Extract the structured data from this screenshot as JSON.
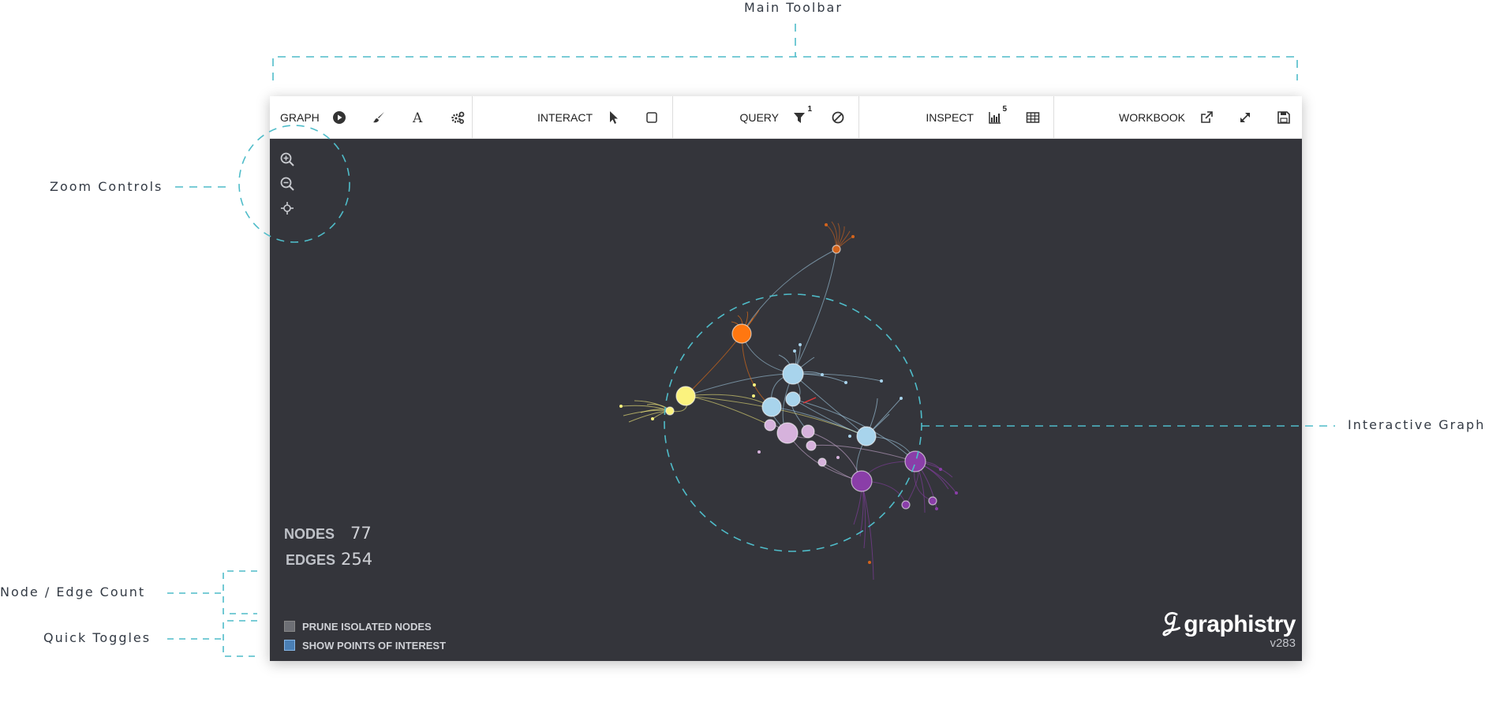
{
  "callouts": {
    "main_toolbar": "Main Toolbar",
    "zoom_controls": "Zoom Controls",
    "interactive_graph": "Interactive Graph",
    "node_edge_count": "Node / Edge Count",
    "quick_toggles": "Quick Toggles"
  },
  "toolbar": {
    "graph": {
      "label": "GRAPH",
      "icons": [
        "play-icon",
        "brush-icon",
        "font-icon",
        "gears-icon"
      ]
    },
    "interact": {
      "label": "INTERACT",
      "icons": [
        "pointer-icon",
        "box-select-icon"
      ]
    },
    "query": {
      "label": "QUERY",
      "filter_badge": "1",
      "icons": [
        "filter-icon",
        "exclude-icon"
      ]
    },
    "inspect": {
      "label": "INSPECT",
      "histogram_badge": "5",
      "icons": [
        "histogram-icon",
        "table-icon"
      ]
    },
    "workbook": {
      "label": "WORKBOOK",
      "icons": [
        "external-link-icon",
        "fullscreen-icon",
        "save-icon"
      ]
    }
  },
  "zoom": [
    "zoom-in-icon",
    "zoom-out-icon",
    "center-icon"
  ],
  "stats": {
    "nodes_label": "NODES",
    "nodes_value": "77",
    "edges_label": "EDGES",
    "edges_value": "254"
  },
  "toggles": {
    "prune_label": "PRUNE ISOLATED NODES",
    "prune_checked": false,
    "poi_label": "SHOW POINTS OF INTEREST",
    "poi_checked": true
  },
  "brand": {
    "name": "graphistry",
    "version": "v283"
  },
  "colors": {
    "accent": "#4fbcc9",
    "canvas": "#34353b",
    "light_blue": "#a8d4ec",
    "orange": "#ff7710",
    "dark_orange": "#d4641c",
    "yellow": "#fbf27e",
    "pink": "#d6b2dc",
    "purple": "#8a3ea8"
  }
}
